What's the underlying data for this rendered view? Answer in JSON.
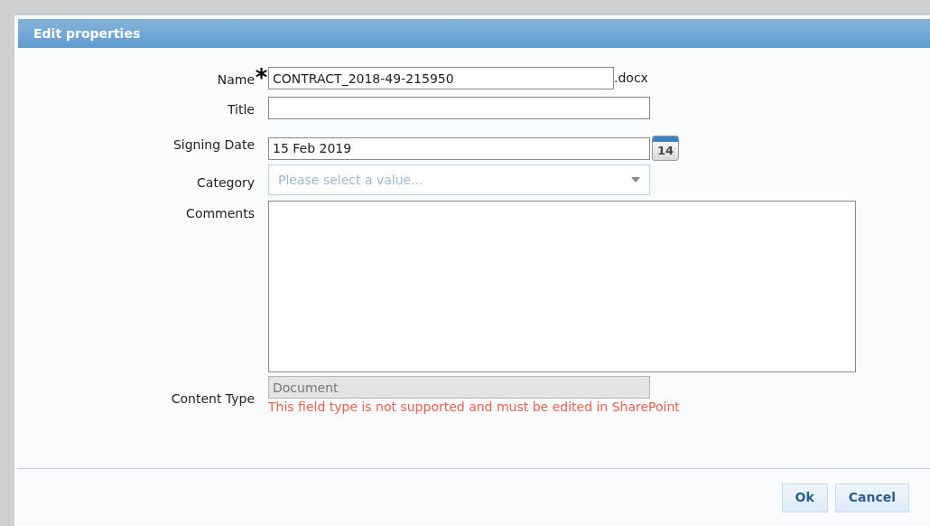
{
  "dialog": {
    "title": "Edit properties"
  },
  "fields": [
    {
      "kind": "text",
      "label": "Name",
      "required_mark": "*",
      "value": "CONTRACT_2018-49-215950",
      "suffix": ".docx"
    },
    {
      "kind": "text",
      "label": "Title"
    },
    {
      "kind": "date",
      "label": "Signing Date",
      "value": "15 Feb 2019",
      "calendar_day": "14"
    },
    {
      "kind": "select",
      "label": "Category",
      "placeholder": "Please select a value..."
    },
    {
      "kind": "textarea",
      "label": "Comments"
    },
    {
      "kind": "readonly",
      "label": "Content Type",
      "value": "Document",
      "error": "This field type is not supported and must be edited in SharePoint"
    }
  ],
  "buttons": [
    "Ok",
    "Cancel"
  ]
}
